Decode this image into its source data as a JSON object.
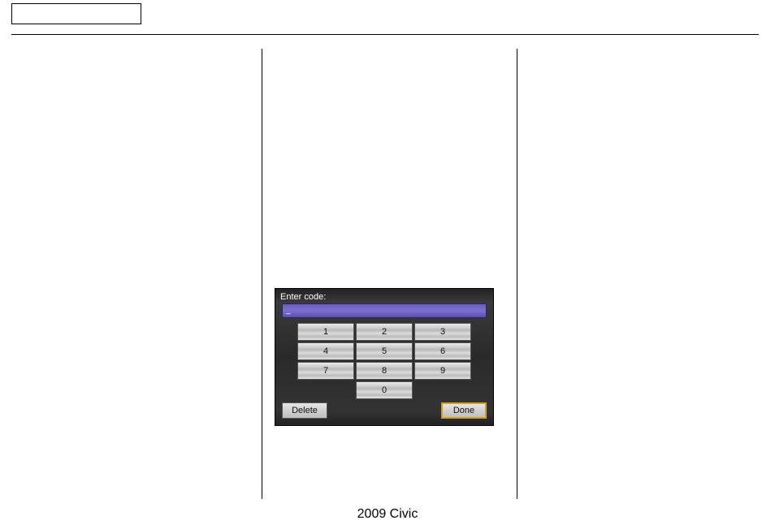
{
  "footer": "2009  Civic",
  "device": {
    "label": "Enter code:",
    "code_value": "_",
    "keys": {
      "k1": "1",
      "k2": "2",
      "k3": "3",
      "k4": "4",
      "k5": "5",
      "k6": "6",
      "k7": "7",
      "k8": "8",
      "k9": "9",
      "k0": "0"
    },
    "delete_label": "Delete",
    "done_label": "Done"
  }
}
